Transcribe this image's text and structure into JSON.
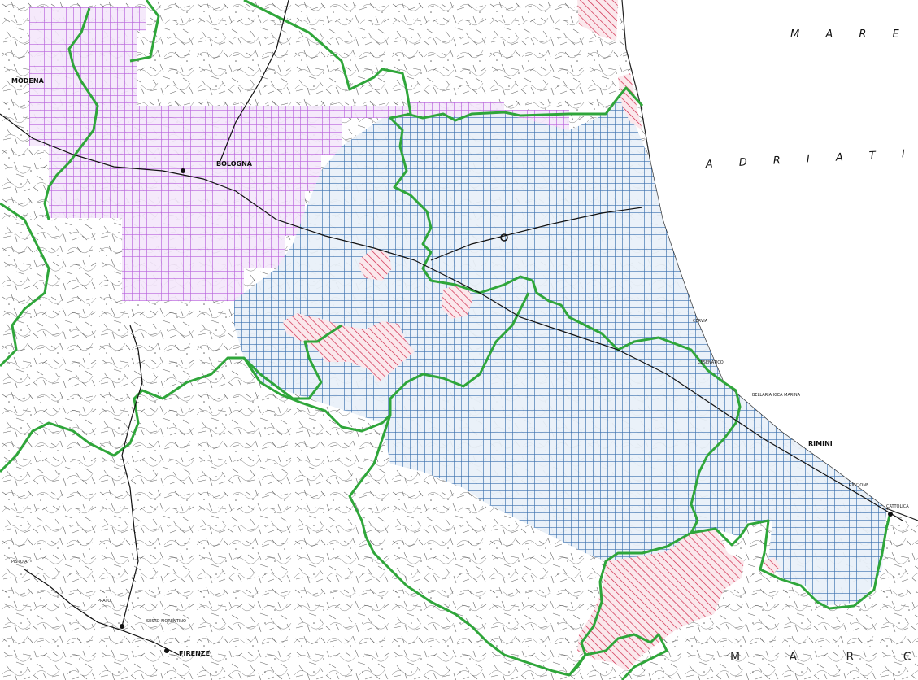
{
  "map": {
    "sea_label_1": "M A R E",
    "sea_label_2": "A D R I A T I C O",
    "region_label": "M A R C H E",
    "cities": {
      "modena": "MODENA",
      "bologna": "BOLOGNA",
      "rimini": "RIMINI",
      "cervia": "CERVIA",
      "cesenatico": "CESENATICO",
      "bellaria": "BELLARIA IGEA MARINA",
      "riccione": "RICCIONE",
      "cattolica": "CATTOLICA",
      "pistoia": "PISTOIA",
      "prato": "PRATO",
      "sesto": "SESTO FIORENTINO",
      "firenze": "FIRENZE"
    }
  },
  "colors": {
    "purple_zone": "#b050d8",
    "blue_zone": "#2a64a8",
    "red_zone": "#d0284a",
    "boundary": "#2fa63a",
    "basemap": "#222222"
  }
}
